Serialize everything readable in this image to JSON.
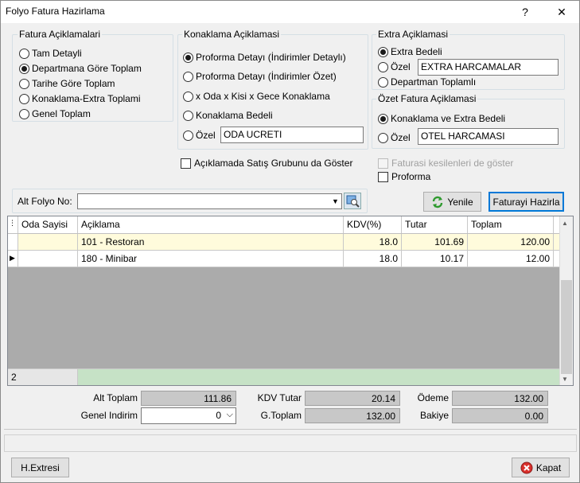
{
  "window": {
    "title": "Folyo Fatura Hazirlama",
    "help_glyph": "?",
    "close_glyph": "✕"
  },
  "fatura_aciklamalari": {
    "legend": "Fatura Açiklamalari",
    "options": [
      "Tam Detayli",
      "Departmana Göre Toplam",
      "Tarihe Göre Toplam",
      "Konaklama-Extra Toplami",
      "Genel Toplam"
    ],
    "selected_index": 1
  },
  "konaklama_aciklamasi": {
    "legend": "Konaklama Açiklamasi",
    "options": [
      "Proforma Detayı  (İndirimler Detaylı)",
      "Proforma Detayı (İndirimler Özet)",
      "x Oda x Kisi x Gece Konaklama",
      "Konaklama Bedeli",
      "Özel"
    ],
    "selected_index": 0,
    "ozel_value": "ODA UCRETI"
  },
  "extra_aciklamasi": {
    "legend": "Extra Açiklamasi",
    "options": [
      "Extra Bedeli",
      "Özel",
      "Departman Toplamlı"
    ],
    "selected_index": 0,
    "ozel_value": "EXTRA HARCAMALAR"
  },
  "ozet_fatura_aciklamasi": {
    "legend": "Özet Fatura Açiklamasi",
    "options": [
      "Konaklama ve Extra Bedeli",
      "Özel"
    ],
    "selected_index": 0,
    "ozel_value": "OTEL HARCAMASI"
  },
  "checkboxes": {
    "satis_grubu": "Açıklamada Satış Grubunu da Göster",
    "faturasi_kesilenler": "Faturasi kesilenleri de göster",
    "proforma": "Proforma"
  },
  "alt_folyo": {
    "label": "Alt Folyo No:",
    "value": ""
  },
  "buttons": {
    "yenile": "Yenile",
    "faturayi_hazirla": "Faturayi Hazirla",
    "h_extresi": "H.Extresi",
    "kapat": "Kapat"
  },
  "grid": {
    "columns": [
      "Oda Sayisi",
      "Açiklama",
      "KDV(%)",
      "Tutar",
      "Toplam"
    ],
    "rows": [
      {
        "oda": "",
        "aciklama": "101 - Restoran",
        "kdv": "18.0",
        "tutar": "101.69",
        "toplam": "120.00",
        "selected": true
      },
      {
        "oda": "",
        "aciklama": "180 - Minibar",
        "kdv": "18.0",
        "tutar": "10.17",
        "toplam": "12.00",
        "selected": false
      }
    ],
    "footer_count": "2"
  },
  "totals": {
    "alt_toplam_label": "Alt Toplam",
    "alt_toplam": "111.86",
    "kdv_tutar_label": "KDV Tutar",
    "kdv_tutar": "20.14",
    "odeme_label": "Ödeme",
    "odeme": "132.00",
    "genel_indirim_label": "Genel Indirim",
    "genel_indirim": "0",
    "g_toplam_label": "G.Toplam",
    "g_toplam": "132.00",
    "bakiye_label": "Bakiye",
    "bakiye": "0.00"
  },
  "colors": {
    "selected_row": "#fffbdc",
    "footer_green": "#c6e2c6",
    "value_box": "#c8c8c8",
    "focus_blue": "#0078d7"
  }
}
